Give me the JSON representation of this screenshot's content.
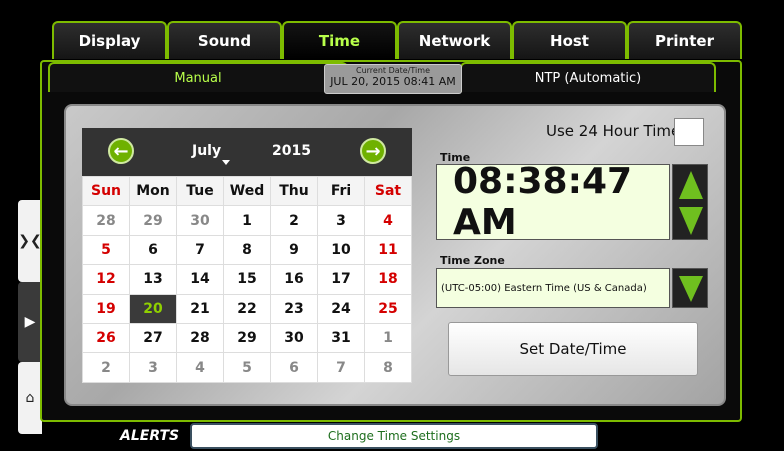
{
  "tabs": [
    {
      "label": "Display"
    },
    {
      "label": "Sound"
    },
    {
      "label": "Time"
    },
    {
      "label": "Network"
    },
    {
      "label": "Host"
    },
    {
      "label": "Printer"
    }
  ],
  "subtabs": {
    "manual": "Manual",
    "ntp": "NTP (Automatic)"
  },
  "current": {
    "label": "Current Date/Time",
    "value": "JUL 20, 2015 08:41 AM"
  },
  "calendar": {
    "month": "July",
    "year": "2015",
    "weekdays": [
      "Sun",
      "Mon",
      "Tue",
      "Wed",
      "Thu",
      "Fri",
      "Sat"
    ],
    "weeks": [
      [
        "28",
        "29",
        "30",
        "1",
        "2",
        "3",
        "4"
      ],
      [
        "5",
        "6",
        "7",
        "8",
        "9",
        "10",
        "11"
      ],
      [
        "12",
        "13",
        "14",
        "15",
        "16",
        "17",
        "18"
      ],
      [
        "19",
        "20",
        "21",
        "22",
        "23",
        "24",
        "25"
      ],
      [
        "26",
        "27",
        "28",
        "29",
        "30",
        "31",
        "1"
      ],
      [
        "2",
        "3",
        "4",
        "5",
        "6",
        "7",
        "8"
      ]
    ],
    "selected_day": "20"
  },
  "use24": {
    "label": "Use 24 Hour Time"
  },
  "time": {
    "label": "Time",
    "value": "08:38:47 AM"
  },
  "timezone": {
    "label": "Time Zone",
    "value": "(UTC-05:00) Eastern Time (US & Canada)"
  },
  "set_button": {
    "label": "Set Date/Time"
  },
  "alerts": {
    "label": "ALERTS",
    "message": "Change Time Settings"
  },
  "colors": {
    "accent": "#7dbb00",
    "weekend": "#d40000"
  }
}
